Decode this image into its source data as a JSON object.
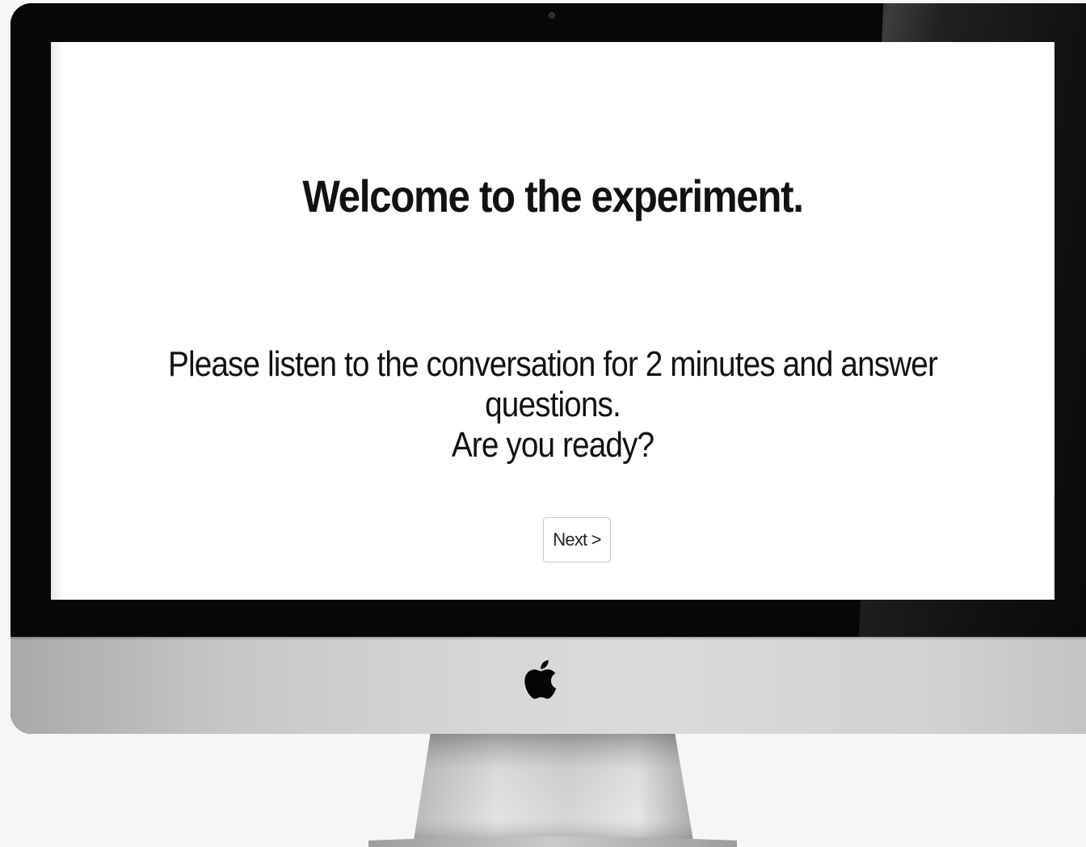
{
  "screen": {
    "heading": "Welcome to the experiment.",
    "instructions": "Please listen to the conversation for 2 minutes and answer questions.",
    "prompt": "Are you ready?",
    "next_button_label": "Next >"
  },
  "device": {
    "logo_icon": "apple-logo-icon",
    "bezel_color": "#070707",
    "chin_color": "#d6d8da"
  }
}
